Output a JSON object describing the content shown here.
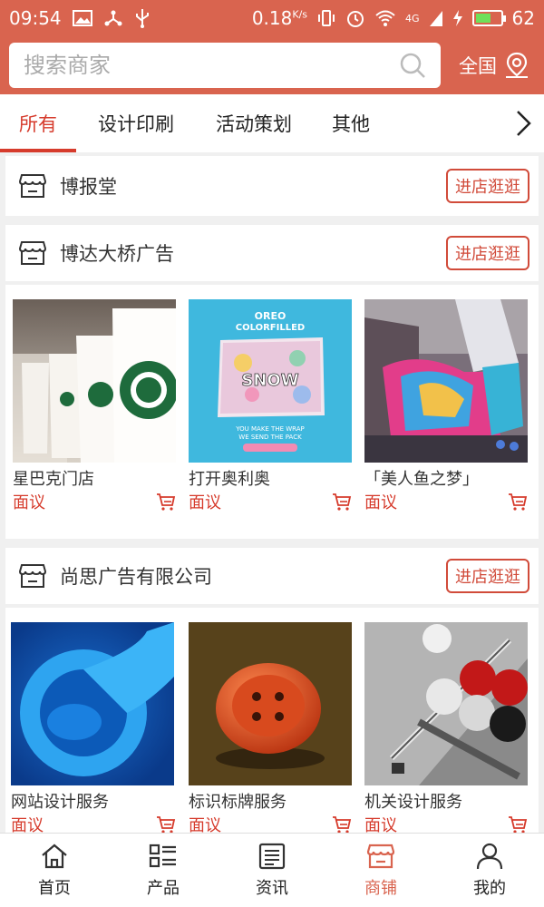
{
  "status_bar": {
    "time": "09:54",
    "speed": "0.18",
    "speed_unit": "K/s",
    "battery": "62",
    "battery_level": 0.62,
    "network": "4G"
  },
  "search": {
    "placeholder": "搜索商家",
    "region_label": "全国"
  },
  "tabs": [
    {
      "label": "所有",
      "active": true
    },
    {
      "label": "设计印刷",
      "active": false
    },
    {
      "label": "活动策划",
      "active": false
    },
    {
      "label": "其他",
      "active": false
    }
  ],
  "stores": [
    {
      "name": "博报堂",
      "visit_label": "进店逛逛",
      "products": []
    },
    {
      "name": "博达大桥广告",
      "visit_label": "进店逛逛",
      "products": [
        {
          "name": "星巴克门店",
          "price": "面议",
          "image": "starbucks-cups"
        },
        {
          "name": "打开奥利奥",
          "price": "面议",
          "image": "oreo-package"
        },
        {
          "name": "「美人鱼之梦」",
          "price": "面议",
          "image": "mermaid-installation"
        }
      ]
    },
    {
      "name": "尚思广告有限公司",
      "visit_label": "进店逛逛",
      "products": [
        {
          "name": "网站设计服务",
          "price": "面议",
          "image": "blue-drop"
        },
        {
          "name": "标识标牌服务",
          "price": "面议",
          "image": "orange-button"
        },
        {
          "name": "机关设计服务",
          "price": "面议",
          "image": "billiard-balls"
        }
      ]
    }
  ],
  "bottom_nav": [
    {
      "label": "首页",
      "icon": "home-icon",
      "active": false
    },
    {
      "label": "产品",
      "icon": "list-icon",
      "active": false
    },
    {
      "label": "资讯",
      "icon": "news-icon",
      "active": false
    },
    {
      "label": "商铺",
      "icon": "store-icon",
      "active": true
    },
    {
      "label": "我的",
      "icon": "user-icon",
      "active": false
    }
  ],
  "colors": {
    "brand": "#d9644f",
    "accent": "#d63b2c"
  }
}
